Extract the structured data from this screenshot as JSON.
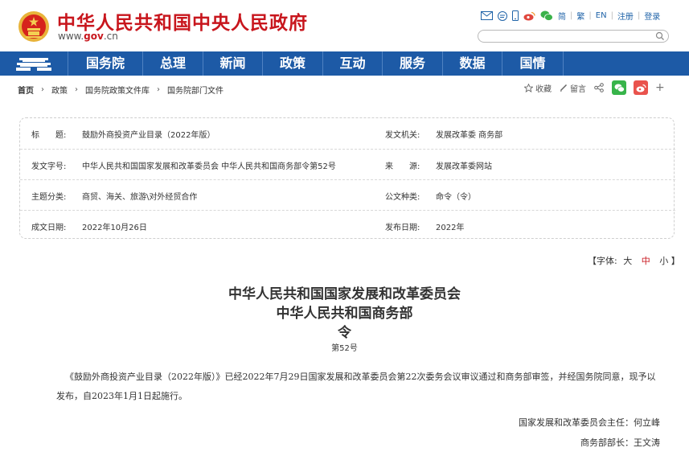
{
  "header": {
    "site_title": "中华人民共和国中央人民政府",
    "domain_prefix": "www.",
    "domain_brand": "gov",
    "domain_suffix": ".cn",
    "links": {
      "simplified": "简",
      "traditional": "繁",
      "english": "EN",
      "register": "注册",
      "login": "登录"
    },
    "search_placeholder": ""
  },
  "nav": {
    "items": [
      "国务院",
      "总理",
      "新闻",
      "政策",
      "互动",
      "服务",
      "数据",
      "国情"
    ]
  },
  "breadcrumb": [
    "首页",
    "政策",
    "国务院政策文件库",
    "国务院部门文件"
  ],
  "tools": {
    "favorite": "收藏",
    "comment": "留言",
    "more": "+"
  },
  "info": {
    "title_label": "标　　题:",
    "title_value": "鼓励外商投资产业目录（2022年版）",
    "issuer_label": "发文机关:",
    "issuer_value": "发展改革委  商务部",
    "doc_no_label": "发文字号:",
    "doc_no_value": "中华人民共和国国家发展和改革委员会  中华人民共和国商务部令第52号",
    "source_label": "来　　源:",
    "source_value": "发展改革委网站",
    "category_label": "主题分类:",
    "category_value": "商贸、海关、旅游\\对外经贸合作",
    "type_label": "公文种类:",
    "type_value": "命令（令）",
    "date_label": "成文日期:",
    "date_value": "2022年10月26日",
    "publish_label": "发布日期:",
    "publish_value": "2022年"
  },
  "font_size": {
    "open": "【字体:",
    "large": "大",
    "medium": "中",
    "small": "小",
    "close": "】"
  },
  "document": {
    "title_line1": "中华人民共和国国家发展和改革委员会",
    "title_line2": "中华人民共和国商务部",
    "title_line3": "令",
    "number": "第52号",
    "body": "《鼓励外商投资产业目录（2022年版）》已经2022年7月29日国家发展和改革委员会第22次委务会议审议通过和商务部审签，并经国务院同意，现予以发布，自2023年1月1日起施行。",
    "signature1": "国家发展和改革委员会主任：何立峰",
    "signature2": "商务部部长：王文涛"
  },
  "colors": {
    "brand_red": "#c8161d",
    "nav_blue": "#1d5aa6",
    "link_blue": "#1f63a8"
  }
}
